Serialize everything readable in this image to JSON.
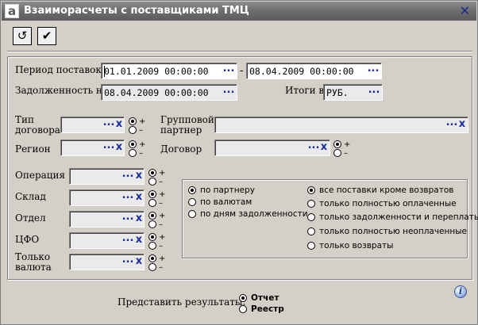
{
  "window": {
    "title": "Взаиморасчеты с поставщиками ТМЦ",
    "app_icon": "a",
    "close_icon": "close-icon"
  },
  "toolbar": {
    "undo_icon": "undo-icon",
    "apply_icon": "checkmark-icon"
  },
  "period": {
    "label": "Период поставок:",
    "from": "01.01.2009 00:00:00",
    "separator": "-",
    "to": "08.04.2009 00:00:00"
  },
  "debt": {
    "label": "Задолженность на:",
    "value": "08.04.2009 00:00:00"
  },
  "totals": {
    "label": "Итоги в:",
    "value": "РУБ."
  },
  "common": {
    "lookup": "...",
    "clear": "x",
    "plus": "+",
    "minus": "–"
  },
  "contract_type": {
    "label": "Тип договора",
    "value": "",
    "mode": "+"
  },
  "group_partner": {
    "label": "Групповой партнер",
    "value": ""
  },
  "region": {
    "label": "Регион",
    "value": "",
    "mode": "+"
  },
  "contract": {
    "label": "Договор",
    "value": "",
    "mode": "+"
  },
  "left_filters": [
    {
      "label": "Операция",
      "value": "",
      "mode": "+"
    },
    {
      "label": "Склад",
      "value": "",
      "mode": "+"
    },
    {
      "label": "Отдел",
      "value": "",
      "mode": "+"
    },
    {
      "label": "ЦФО",
      "value": "",
      "mode": "+"
    },
    {
      "label": "Только валюта",
      "value": "",
      "mode": "+"
    }
  ],
  "grouping": {
    "options": [
      "по партнеру",
      "по валютам",
      "по дням задолженности"
    ],
    "selected": "по партнеру"
  },
  "filter": {
    "options": [
      "все поставки кроме возвратов",
      "только полностью оплаченные",
      "только задолженности и переплаты",
      "только полностью неоплаченные",
      "только возвраты"
    ],
    "selected": "все поставки кроме возвратов"
  },
  "present": {
    "label": "Представить результаты:",
    "options": [
      "Отчет",
      "Реестр"
    ],
    "selected": "Отчет"
  },
  "info_icon": "info-icon"
}
